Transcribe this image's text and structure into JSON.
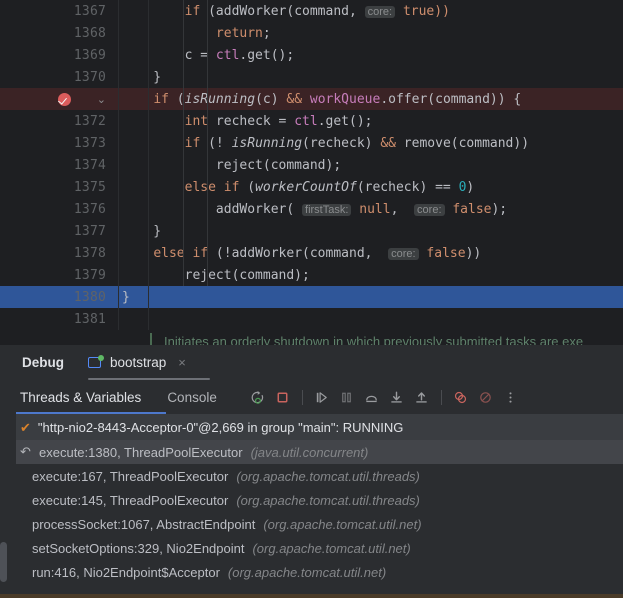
{
  "editor": {
    "lines": [
      {
        "num": "1367",
        "partial": true,
        "state": "normal",
        "tokens": [
          {
            "t": "        ",
            "c": "pun"
          },
          {
            "t": "if ",
            "c": "kw"
          },
          {
            "t": "(addWorker(command, ",
            "c": "pun"
          },
          {
            "t": "core:",
            "c": "hint"
          },
          {
            "t": " true))",
            "c": "lit"
          }
        ]
      },
      {
        "num": "1368",
        "state": "normal",
        "tokens": [
          {
            "t": "            ",
            "c": "pun"
          },
          {
            "t": "return",
            "c": "kw"
          },
          {
            "t": ";",
            "c": "pun"
          }
        ]
      },
      {
        "num": "1369",
        "state": "normal",
        "tokens": [
          {
            "t": "        c = ",
            "c": "pun"
          },
          {
            "t": "ctl",
            "c": "fld"
          },
          {
            "t": ".get();",
            "c": "pun"
          }
        ]
      },
      {
        "num": "1370",
        "state": "normal",
        "tokens": [
          {
            "t": "    }",
            "c": "pun"
          }
        ]
      },
      {
        "num": "1371",
        "state": "breakpoint",
        "breakpoint": true,
        "tokens": [
          {
            "t": "    ",
            "c": "pun"
          },
          {
            "t": "if",
            "c": "kw"
          },
          {
            "t": " (",
            "c": "pun"
          },
          {
            "t": "isRunning",
            "c": "itl"
          },
          {
            "t": "(c) ",
            "c": "pun"
          },
          {
            "t": "&&",
            "c": "kw"
          },
          {
            "t": " ",
            "c": "pun"
          },
          {
            "t": "workQueue",
            "c": "fld"
          },
          {
            "t": ".offer(command)) {",
            "c": "pun"
          }
        ]
      },
      {
        "num": "1372",
        "state": "normal",
        "tokens": [
          {
            "t": "        ",
            "c": "pun"
          },
          {
            "t": "int",
            "c": "kw"
          },
          {
            "t": " recheck = ",
            "c": "pun"
          },
          {
            "t": "ctl",
            "c": "fld"
          },
          {
            "t": ".get();",
            "c": "pun"
          }
        ]
      },
      {
        "num": "1373",
        "state": "normal",
        "tokens": [
          {
            "t": "        ",
            "c": "pun"
          },
          {
            "t": "if",
            "c": "kw"
          },
          {
            "t": " (! ",
            "c": "pun"
          },
          {
            "t": "isRunning",
            "c": "itl"
          },
          {
            "t": "(recheck) ",
            "c": "pun"
          },
          {
            "t": "&&",
            "c": "kw"
          },
          {
            "t": " remove(command))",
            "c": "pun"
          }
        ]
      },
      {
        "num": "1374",
        "state": "normal",
        "tokens": [
          {
            "t": "            reject(command);",
            "c": "pun"
          }
        ]
      },
      {
        "num": "1375",
        "state": "normal",
        "tokens": [
          {
            "t": "        ",
            "c": "pun"
          },
          {
            "t": "else if",
            "c": "kw"
          },
          {
            "t": " (",
            "c": "pun"
          },
          {
            "t": "workerCountOf",
            "c": "itl"
          },
          {
            "t": "(recheck) == ",
            "c": "pun"
          },
          {
            "t": "0",
            "c": "num"
          },
          {
            "t": ")",
            "c": "pun"
          }
        ]
      },
      {
        "num": "1376",
        "state": "normal",
        "tokens": [
          {
            "t": "            addWorker( ",
            "c": "pun"
          },
          {
            "t": "firstTask:",
            "c": "hint"
          },
          {
            "t": " null",
            "c": "lit"
          },
          {
            "t": ",  ",
            "c": "pun"
          },
          {
            "t": "core:",
            "c": "hint"
          },
          {
            "t": " false",
            "c": "lit"
          },
          {
            "t": ");",
            "c": "pun"
          }
        ]
      },
      {
        "num": "1377",
        "state": "normal",
        "tokens": [
          {
            "t": "    }",
            "c": "pun"
          }
        ]
      },
      {
        "num": "1378",
        "state": "normal",
        "tokens": [
          {
            "t": "    ",
            "c": "pun"
          },
          {
            "t": "else if",
            "c": "kw"
          },
          {
            "t": " (!addWorker(command,  ",
            "c": "pun"
          },
          {
            "t": "core:",
            "c": "hint"
          },
          {
            "t": " false",
            "c": "lit"
          },
          {
            "t": "))",
            "c": "pun"
          }
        ]
      },
      {
        "num": "1379",
        "state": "normal",
        "tokens": [
          {
            "t": "        reject(command);",
            "c": "pun"
          }
        ]
      },
      {
        "num": "1380",
        "state": "selected",
        "tokens": [
          {
            "t": "}",
            "c": "pun"
          }
        ]
      },
      {
        "num": "1381",
        "state": "normal",
        "tokens": []
      }
    ],
    "doc_comment": "Initiates an orderly shutdown in which previously submitted tasks are exe"
  },
  "debug": {
    "panel_title": "Debug",
    "run_tab_label": "bootstrap",
    "run_tab_close": "×",
    "tabs": [
      {
        "label": "Threads & Variables",
        "active": true
      },
      {
        "label": "Console",
        "active": false
      }
    ],
    "toolbar_buttons": [
      {
        "name": "rerun-icon",
        "title": "Rerun"
      },
      {
        "name": "stop-icon",
        "title": "Stop"
      },
      {
        "name": "resume-icon",
        "title": "Resume Program"
      },
      {
        "name": "pause-icon",
        "title": "Pause Program"
      },
      {
        "name": "step-over-icon",
        "title": "Step Over"
      },
      {
        "name": "step-into-icon",
        "title": "Step Into"
      },
      {
        "name": "step-out-icon",
        "title": "Step Out"
      },
      {
        "name": "view-breakpoints-icon",
        "title": "View Breakpoints"
      },
      {
        "name": "mute-breakpoints-icon",
        "title": "Mute Breakpoints"
      },
      {
        "name": "more-options-icon",
        "title": "More"
      }
    ],
    "thread": {
      "status_icon": "✔",
      "label": "\"http-nio2-8443-Acceptor-0\"@2,669 in group \"main\": RUNNING"
    },
    "frames": [
      {
        "icon": "↶",
        "method": "execute:1380, ThreadPoolExecutor",
        "package": "(java.util.concurrent)",
        "selected": true,
        "indent": false
      },
      {
        "icon": "",
        "method": "execute:167, ThreadPoolExecutor",
        "package": "(org.apache.tomcat.util.threads)",
        "selected": false,
        "indent": true
      },
      {
        "icon": "",
        "method": "execute:145, ThreadPoolExecutor",
        "package": "(org.apache.tomcat.util.threads)",
        "selected": false,
        "indent": true
      },
      {
        "icon": "",
        "method": "processSocket:1067, AbstractEndpoint",
        "package": "(org.apache.tomcat.util.net)",
        "selected": false,
        "indent": true
      },
      {
        "icon": "",
        "method": "setSocketOptions:329, Nio2Endpoint",
        "package": "(org.apache.tomcat.util.net)",
        "selected": false,
        "indent": true
      },
      {
        "icon": "",
        "method": "run:416, Nio2Endpoint$Acceptor",
        "package": "(org.apache.tomcat.util.net)",
        "selected": false,
        "indent": true
      }
    ]
  },
  "colors": {
    "editor_bg": "#1e1f22",
    "panel_bg": "#2b2d30",
    "breakpoint_line": "#3b2325",
    "selected_line": "#2f5699",
    "accent_blue": "#4d78cc",
    "breakpoint_red": "#db5c5c",
    "running_green": "#5fb865"
  }
}
